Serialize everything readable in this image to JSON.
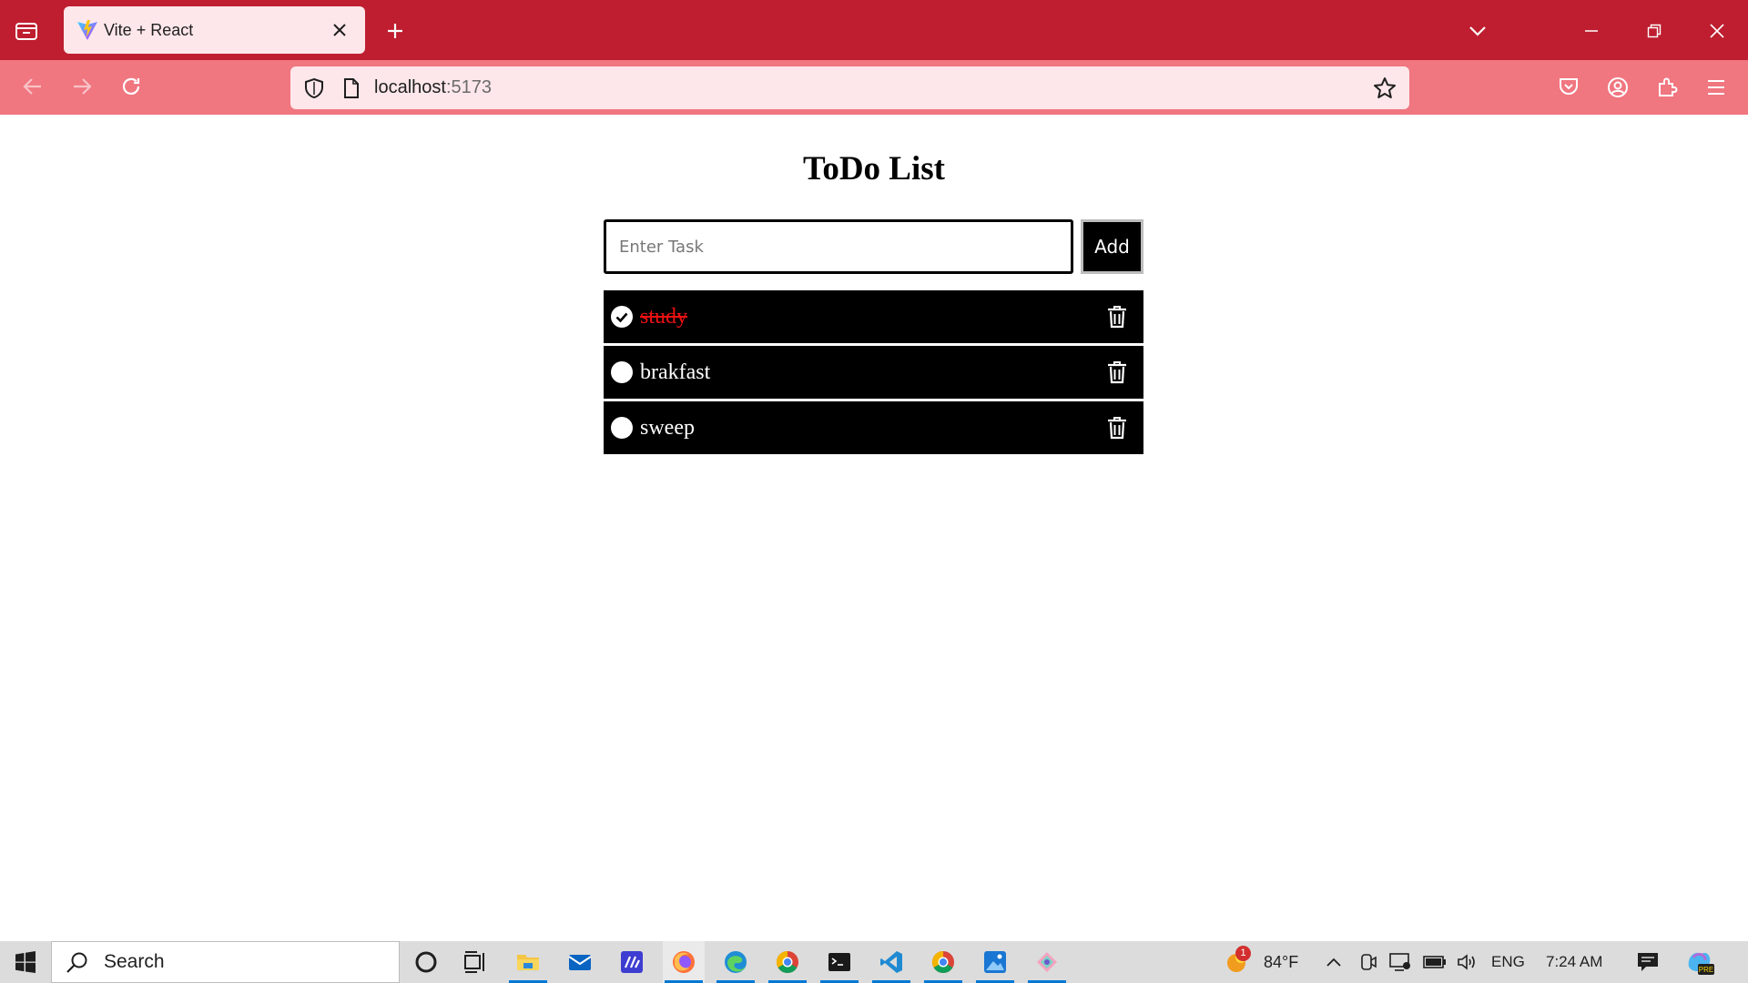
{
  "browser": {
    "tab": {
      "title": "Vite + React"
    },
    "url": {
      "host": "localhost",
      "port": ":5173"
    }
  },
  "todo": {
    "title": "ToDo List",
    "input": {
      "value": "",
      "placeholder": "Enter Task"
    },
    "add_label": "Add",
    "items": [
      {
        "text": "study",
        "done": true
      },
      {
        "text": "brakfast",
        "done": false
      },
      {
        "text": "sweep",
        "done": false
      }
    ]
  },
  "taskbar": {
    "search_label": "Search",
    "weather": {
      "temp": "84°F",
      "badge": "1"
    },
    "language": "ENG",
    "time": "7:24 AM"
  }
}
